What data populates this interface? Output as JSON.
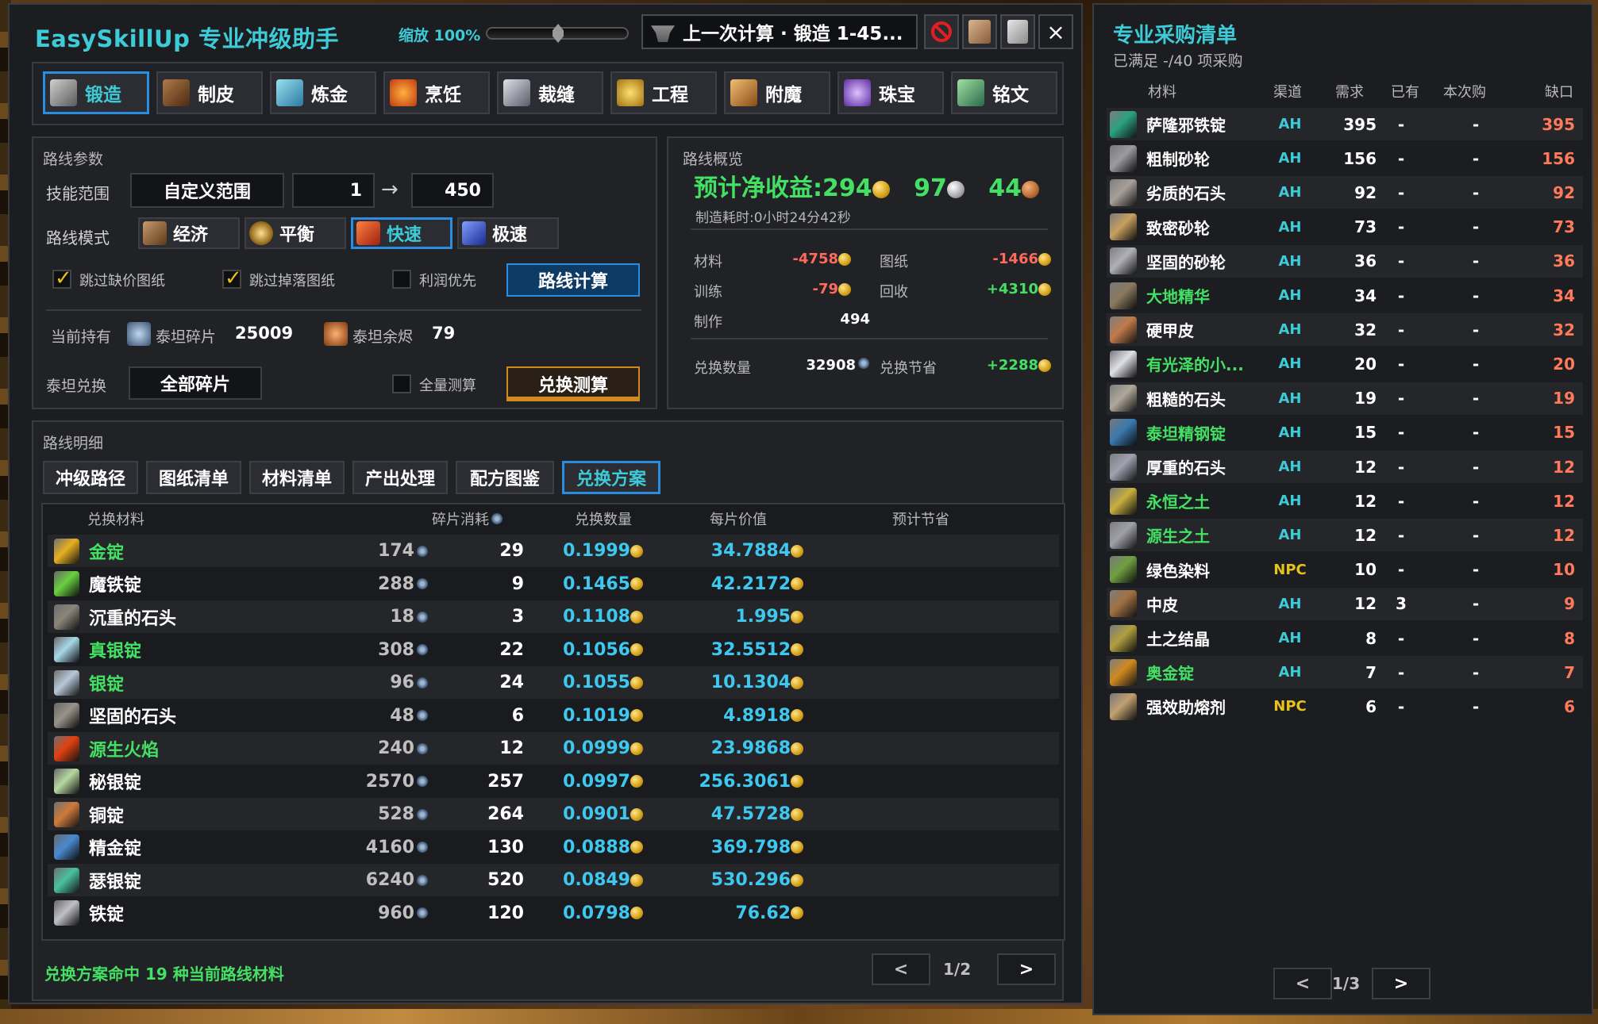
{
  "app": {
    "title": "EasySkillUp 专业冲级助手",
    "zoom_label": "缩放 100%",
    "last_calc": "上一次计算 · 锻造 1-45...",
    "close": "×"
  },
  "professions": [
    {
      "label": "锻造",
      "color": "#8a8a8a",
      "active": true
    },
    {
      "label": "制皮",
      "color": "#8a5a2a"
    },
    {
      "label": "炼金",
      "color": "#3aa0c8"
    },
    {
      "label": "烹饪",
      "color": "#d05a1a"
    },
    {
      "label": "裁缝",
      "color": "#a0a0b0"
    },
    {
      "label": "工程",
      "color": "#c8a020"
    },
    {
      "label": "附魔",
      "color": "#c87a2a"
    },
    {
      "label": "珠宝",
      "color": "#9a6ad0"
    },
    {
      "label": "铭文",
      "color": "#5ab070"
    }
  ],
  "params": {
    "title": "路线参数",
    "skill_range_label": "技能范围",
    "range_mode": "自定义范围",
    "range_from": "1",
    "arrow": "→",
    "range_to": "450",
    "mode_label": "路线模式",
    "modes": [
      {
        "label": "经济",
        "color": "#8a5a3a"
      },
      {
        "label": "平衡",
        "color": "#c8a030"
      },
      {
        "label": "快速",
        "color": "#d04020",
        "active": true
      },
      {
        "label": "极速",
        "color": "#2050d0"
      }
    ],
    "skip_missing": "跳过缺价图纸",
    "skip_drop": "跳过掉落图纸",
    "profit_first": "利润优先",
    "calc_button": "路线计算",
    "holding_label": "当前持有",
    "titan_shard_label": "泰坦碎片",
    "titan_shard_value": "25009",
    "titan_ember_label": "泰坦余烬",
    "titan_ember_value": "79",
    "exchange_label": "泰坦兑换",
    "exchange_mode": "全部碎片",
    "full_measure": "全量测算",
    "exchange_button": "兑换测算"
  },
  "overview": {
    "title": "路线概览",
    "income_label": "预计净收益:294",
    "income_silver": "97",
    "income_copper": "44",
    "craft_time": "制造耗时:0小时24分42秒",
    "material_label": "材料",
    "material_value": "-4758",
    "recipe_label": "图纸",
    "recipe_value": "-1466",
    "training_label": "训练",
    "training_value": "-79",
    "recycle_label": "回收",
    "recycle_value": "+4310",
    "craft_label": "制作",
    "craft_value": "494",
    "exchange_count_label": "兑换数量",
    "exchange_count_value": "32908",
    "exchange_save_label": "兑换节省",
    "exchange_save_value": "+2288"
  },
  "detail": {
    "title": "路线明细",
    "tabs": [
      {
        "label": "冲级路径"
      },
      {
        "label": "图纸清单"
      },
      {
        "label": "材料清单"
      },
      {
        "label": "产出处理"
      },
      {
        "label": "配方图鉴"
      },
      {
        "label": "兑换方案",
        "active": true
      }
    ],
    "headers": {
      "material": "兑换材料",
      "shards": "碎片消耗",
      "count": "兑换数量",
      "per_value": "每片价值",
      "saving": "预计节省"
    },
    "rows": [
      {
        "name": "金锭",
        "green": true,
        "shards": "174",
        "count": "29",
        "per": "0.1999",
        "save": "34.7884",
        "color": "#e8b020"
      },
      {
        "name": "魔铁锭",
        "shards": "288",
        "count": "9",
        "per": "0.1465",
        "save": "42.2172",
        "color": "#6ad040"
      },
      {
        "name": "沉重的石头",
        "shards": "18",
        "count": "3",
        "per": "0.1108",
        "save": "1.995",
        "color": "#8a8478"
      },
      {
        "name": "真银锭",
        "green": true,
        "shards": "308",
        "count": "22",
        "per": "0.1056",
        "save": "32.5512",
        "color": "#a8d8e8"
      },
      {
        "name": "银锭",
        "green": true,
        "shards": "96",
        "count": "24",
        "per": "0.1055",
        "save": "10.1304",
        "color": "#b8c8d8"
      },
      {
        "name": "坚固的石头",
        "shards": "48",
        "count": "6",
        "per": "0.1019",
        "save": "4.8918",
        "color": "#9a9288"
      },
      {
        "name": "源生火焰",
        "green": true,
        "shards": "240",
        "count": "12",
        "per": "0.0999",
        "save": "23.9868",
        "color": "#e04010"
      },
      {
        "name": "秘银锭",
        "shards": "2570",
        "count": "257",
        "per": "0.0997",
        "save": "256.3061",
        "color": "#b8d8a0"
      },
      {
        "name": "铜锭",
        "shards": "528",
        "count": "264",
        "per": "0.0901",
        "save": "47.5728",
        "color": "#d07a3a"
      },
      {
        "name": "精金锭",
        "shards": "4160",
        "count": "130",
        "per": "0.0888",
        "save": "369.798",
        "color": "#4a8ad0"
      },
      {
        "name": "瑟银锭",
        "shards": "6240",
        "count": "520",
        "per": "0.0849",
        "save": "530.296",
        "color": "#4ac0a0"
      },
      {
        "name": "铁锭",
        "shards": "960",
        "count": "120",
        "per": "0.0798",
        "save": "76.62",
        "color": "#c0c0c8"
      }
    ],
    "status": "兑换方案命中 19 种当前路线材料",
    "prev": "<",
    "page": "1/2",
    "next": ">"
  },
  "shopping": {
    "title": "专业采购清单",
    "subtitle": "已满足 -/40 项采购",
    "headers": {
      "material": "材料",
      "source": "渠道",
      "need": "需求",
      "have": "已有",
      "buy": "本次购",
      "gap": "缺口"
    },
    "rows": [
      {
        "name": "萨隆邪铁锭",
        "src": "AH",
        "need": "395",
        "have": "-",
        "buy": "-",
        "gap": "395",
        "color": "#2aa080"
      },
      {
        "name": "粗制砂轮",
        "src": "AH",
        "need": "156",
        "have": "-",
        "buy": "-",
        "gap": "156",
        "color": "#9a9aa0"
      },
      {
        "name": "劣质的石头",
        "src": "AH",
        "need": "92",
        "have": "-",
        "buy": "-",
        "gap": "92",
        "color": "#a8a098"
      },
      {
        "name": "致密砂轮",
        "src": "AH",
        "need": "73",
        "have": "-",
        "buy": "-",
        "gap": "73",
        "color": "#c8a060"
      },
      {
        "name": "坚固的砂轮",
        "src": "AH",
        "need": "36",
        "have": "-",
        "buy": "-",
        "gap": "36",
        "color": "#b0b0b8"
      },
      {
        "name": "大地精华",
        "green": true,
        "src": "AH",
        "need": "34",
        "have": "-",
        "buy": "-",
        "gap": "34",
        "color": "#8a7a60"
      },
      {
        "name": "硬甲皮",
        "src": "AH",
        "need": "32",
        "have": "-",
        "buy": "-",
        "gap": "32",
        "color": "#c07a4a"
      },
      {
        "name": "有光泽的小...",
        "green": true,
        "src": "AH",
        "need": "20",
        "have": "-",
        "buy": "-",
        "gap": "20",
        "color": "#e0e0e8"
      },
      {
        "name": "粗糙的石头",
        "src": "AH",
        "need": "19",
        "have": "-",
        "buy": "-",
        "gap": "19",
        "color": "#b0a898"
      },
      {
        "name": "泰坦精钢锭",
        "green": true,
        "src": "AH",
        "need": "15",
        "have": "-",
        "buy": "-",
        "gap": "15",
        "color": "#3a7ab0"
      },
      {
        "name": "厚重的石头",
        "src": "AH",
        "need": "12",
        "have": "-",
        "buy": "-",
        "gap": "12",
        "color": "#a0a0b0"
      },
      {
        "name": "永恒之土",
        "green": true,
        "src": "AH",
        "need": "12",
        "have": "-",
        "buy": "-",
        "gap": "12",
        "color": "#c8b040"
      },
      {
        "name": "源生之土",
        "green": true,
        "src": "AH",
        "need": "12",
        "have": "-",
        "buy": "-",
        "gap": "12",
        "color": "#a0a0a8"
      },
      {
        "name": "绿色染料",
        "src": "NPC",
        "need": "10",
        "have": "-",
        "buy": "-",
        "gap": "10",
        "color": "#70a040"
      },
      {
        "name": "中皮",
        "src": "AH",
        "need": "12",
        "have": "3",
        "buy": "-",
        "gap": "9",
        "color": "#a07040"
      },
      {
        "name": "土之结晶",
        "src": "AH",
        "need": "8",
        "have": "-",
        "buy": "-",
        "gap": "8",
        "color": "#b0a040"
      },
      {
        "name": "奥金锭",
        "green": true,
        "src": "AH",
        "need": "7",
        "have": "-",
        "buy": "-",
        "gap": "7",
        "color": "#d08a20"
      },
      {
        "name": "强效助熔剂",
        "src": "NPC",
        "need": "6",
        "have": "-",
        "buy": "-",
        "gap": "6",
        "color": "#c0a070"
      }
    ],
    "prev": "<",
    "page": "1/3",
    "next": ">"
  }
}
